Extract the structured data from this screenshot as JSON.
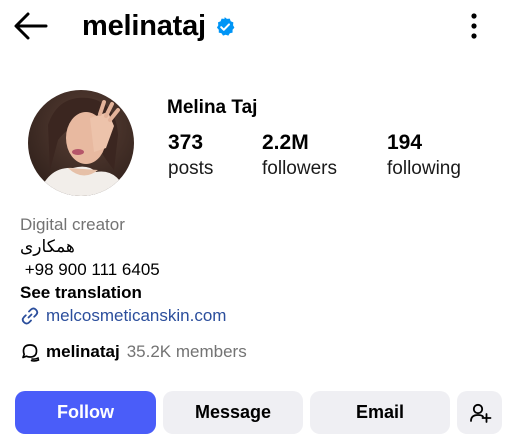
{
  "header": {
    "username": "melinataj",
    "verified": true,
    "accent_color": "#0095f6"
  },
  "profile": {
    "full_name": "Melina Taj",
    "stats": [
      {
        "value": "373",
        "label": "posts"
      },
      {
        "value": "2.2M",
        "label": "followers"
      },
      {
        "value": "194",
        "label": "following"
      }
    ]
  },
  "bio": {
    "category": "Digital creator",
    "line1": "همکاری",
    "line2": " +98 900 111 6405",
    "translate": "See translation",
    "link": "melcosmeticanskin.com",
    "link_color": "#2b4e9c"
  },
  "channel": {
    "name": "melinataj",
    "members": "35.2K members"
  },
  "actions": {
    "follow": "Follow",
    "message": "Message",
    "email": "Email",
    "follow_color": "#4a5df9"
  },
  "icons": {
    "back": "arrow-left-icon",
    "verified": "verified-badge-icon",
    "more": "more-vertical-icon",
    "link": "link-icon",
    "channel": "broadcast-channel-icon",
    "add_user": "add-user-icon"
  }
}
